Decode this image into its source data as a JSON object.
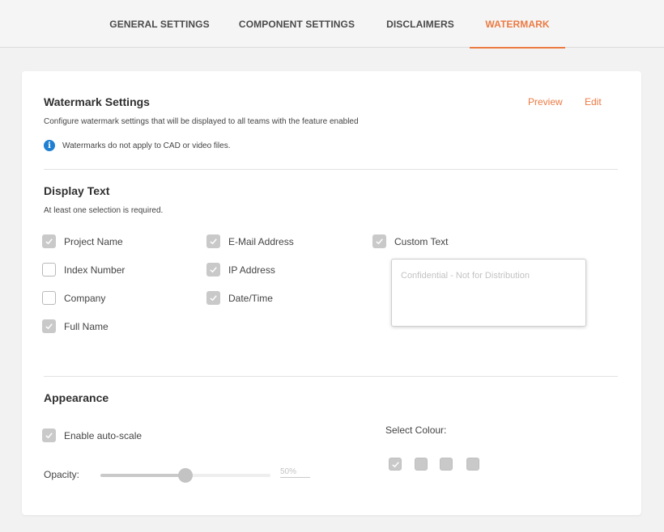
{
  "tabs": [
    {
      "label": "GENERAL SETTINGS",
      "active": false
    },
    {
      "label": "COMPONENT SETTINGS",
      "active": false
    },
    {
      "label": "DISCLAIMERS",
      "active": false
    },
    {
      "label": "WATERMARK",
      "active": true
    }
  ],
  "colors": {
    "accent": "#ec7a43",
    "info": "#1f7fd1",
    "checkbox_checked": "#c9c9c9",
    "background": "#f2f2f2"
  },
  "watermark": {
    "title": "Watermark Settings",
    "description": "Configure watermark settings that will be displayed to all teams with the feature enabled",
    "preview_label": "Preview",
    "edit_label": "Edit",
    "info_icon": "info-icon",
    "info_text": "Watermarks do not apply to CAD or video files."
  },
  "display_text": {
    "title": "Display Text",
    "subtitle": "At least one selection is required.",
    "options": {
      "project_name": {
        "label": "Project Name",
        "checked": true
      },
      "index_number": {
        "label": "Index Number",
        "checked": false
      },
      "company": {
        "label": "Company",
        "checked": false
      },
      "full_name": {
        "label": "Full Name",
        "checked": true
      },
      "email": {
        "label": "E-Mail Address",
        "checked": true
      },
      "ip_address": {
        "label": "IP Address",
        "checked": true
      },
      "date_time": {
        "label": "Date/Time",
        "checked": true
      },
      "custom_text": {
        "label": "Custom Text",
        "checked": true
      }
    },
    "custom_text_placeholder": "Confidential - Not for Distribution"
  },
  "appearance": {
    "title": "Appearance",
    "auto_scale": {
      "label": "Enable auto-scale",
      "checked": true
    },
    "opacity_label": "Opacity:",
    "opacity_value": "50%",
    "opacity_fraction": 0.5,
    "select_colour_label": "Select Colour:",
    "swatches": [
      {
        "name": "colour-swatch-1",
        "selected": true
      },
      {
        "name": "colour-swatch-2",
        "selected": false
      },
      {
        "name": "colour-swatch-3",
        "selected": false
      },
      {
        "name": "colour-swatch-4",
        "selected": false
      }
    ]
  }
}
